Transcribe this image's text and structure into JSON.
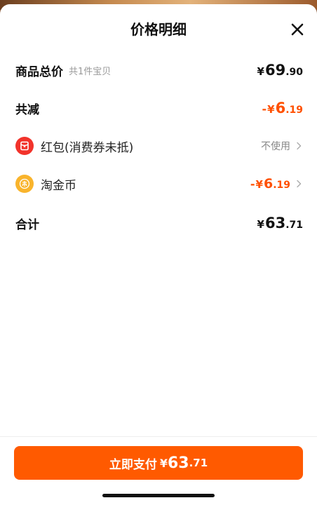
{
  "sheet": {
    "title": "价格明细"
  },
  "rows": {
    "goods_total": {
      "label": "商品总价",
      "sub": "共1件宝贝",
      "symbol": "¥",
      "int": "69",
      "dec": ".90"
    },
    "total_reduction": {
      "label": "共减",
      "minus": "-",
      "symbol": "¥",
      "int": "6",
      "dec": ".19"
    },
    "red_packet": {
      "label": "红包(消费券未抵)",
      "value": "不使用",
      "icon": "red-packet-icon"
    },
    "tao_coin": {
      "label": "淘金币",
      "minus": "-",
      "symbol": "¥",
      "int": "6",
      "dec": ".19",
      "icon": "tao-coin-icon"
    },
    "total": {
      "label": "合计",
      "symbol": "¥",
      "int": "63",
      "dec": ".71"
    }
  },
  "pay_button": {
    "label": "立即支付",
    "symbol": "¥",
    "int": "63",
    "dec": ".71"
  },
  "colors": {
    "accent": "#ff5000",
    "button": "#ff5a00",
    "red_icon": "#f2332b",
    "gold_icon": "#f9b42c"
  }
}
